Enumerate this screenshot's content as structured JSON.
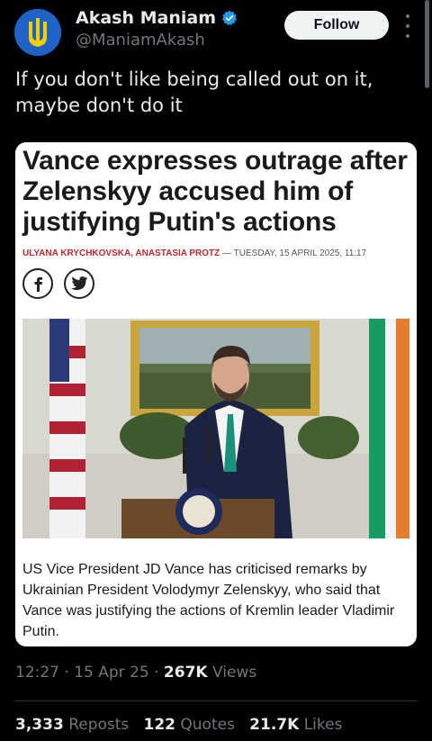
{
  "author": {
    "name": "Akash Maniam",
    "handle": "@ManiamAkash",
    "verified": true,
    "avatar_colors": {
      "blue": "#1f63c6",
      "yellow": "#f5d000"
    }
  },
  "follow_label": "Follow",
  "tweet_text": "If you don't like being called out on it, maybe don't do it",
  "article": {
    "headline": "Vance expresses outrage after Zelenskyy accused him of justifying Putin's actions",
    "authors": "ULYANA KRYCHKOVSKA, ANASTASIA PROTZ",
    "separator": " — ",
    "date": "TUESDAY, 15 APRIL 2025, 11:17",
    "share_icons": [
      "facebook-icon",
      "twitter-icon"
    ],
    "caption": "US Vice President JD Vance has criticised remarks by Ukrainian President Volodymyr Zelenskyy, who said that Vance was justifying the actions of Kremlin leader Vladimir Putin."
  },
  "meta": {
    "time": "12:27",
    "date": "15 Apr 25",
    "views_count": "267K",
    "views_label": "Views"
  },
  "stats": {
    "reposts_count": "3,333",
    "reposts_label": "Reposts",
    "quotes_count": "122",
    "quotes_label": "Quotes",
    "likes_count": "21.7K",
    "likes_label": "Likes"
  },
  "colors": {
    "background": "#000000",
    "text": "#e7e9ea",
    "muted": "#71767b",
    "verified": "#1d9bf0",
    "byline_red": "#c4262e"
  }
}
